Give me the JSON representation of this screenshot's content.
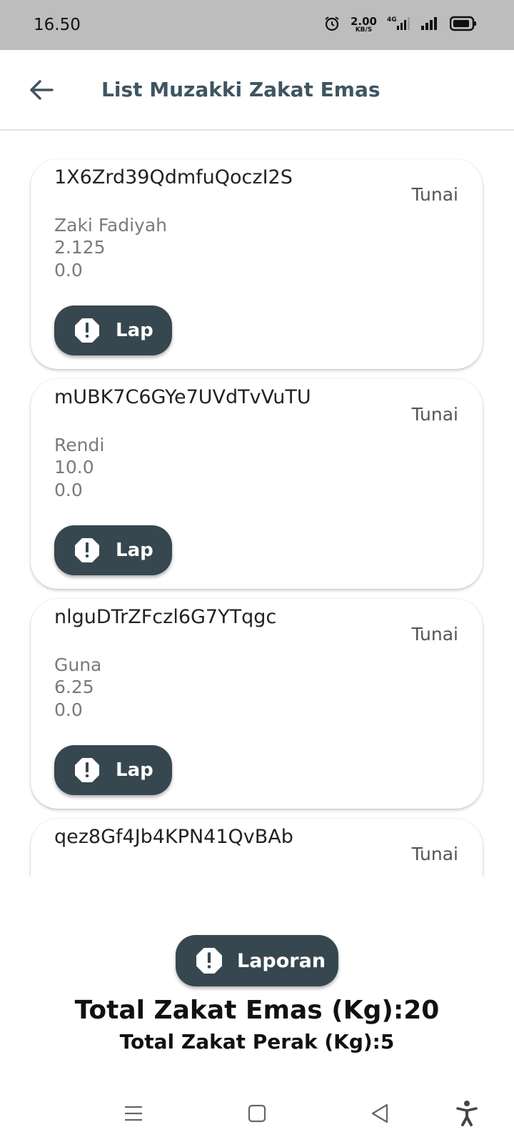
{
  "status_bar": {
    "time": "16.50",
    "net_speed_value": "2.00",
    "net_speed_unit": "KB/S",
    "network": "4G"
  },
  "app_bar": {
    "title": "List Muzakki Zakat Emas"
  },
  "list": {
    "items": [
      {
        "id": "1X6Zrd39QdmfuQoczI2S",
        "method": "Tunai",
        "name": "Zaki Fadiyah",
        "value1": "2.125",
        "value2": "0.0",
        "button_label": "Lap"
      },
      {
        "id": "mUBK7C6GYe7UVdTvVuTU",
        "method": "Tunai",
        "name": "Rendi",
        "value1": "10.0",
        "value2": "0.0",
        "button_label": "Lap"
      },
      {
        "id": "nlguDTrZFczl6G7YTqgc",
        "method": "Tunai",
        "name": "Guna",
        "value1": "6.25",
        "value2": "0.0",
        "button_label": "Lap"
      },
      {
        "id": "qez8Gf4Jb4KPN41QvBAb",
        "method": "Tunai",
        "name": "",
        "value1": "",
        "value2": "",
        "button_label": ""
      }
    ]
  },
  "footer": {
    "report_button_label": "Laporan",
    "total_gold": "Total Zakat Emas (Kg):20",
    "total_silver": "Total Zakat Perak (Kg):5"
  },
  "colors": {
    "status_bar_bg": "#bdbdbd",
    "button_bg": "#37474f",
    "title_color": "#3f5561"
  },
  "icons": {
    "back": "arrow-left-icon",
    "alert": "alert-octagon-icon",
    "nav_menu": "menu-icon",
    "nav_home": "square-icon",
    "nav_back": "triangle-back-icon",
    "accessibility": "accessibility-icon"
  }
}
